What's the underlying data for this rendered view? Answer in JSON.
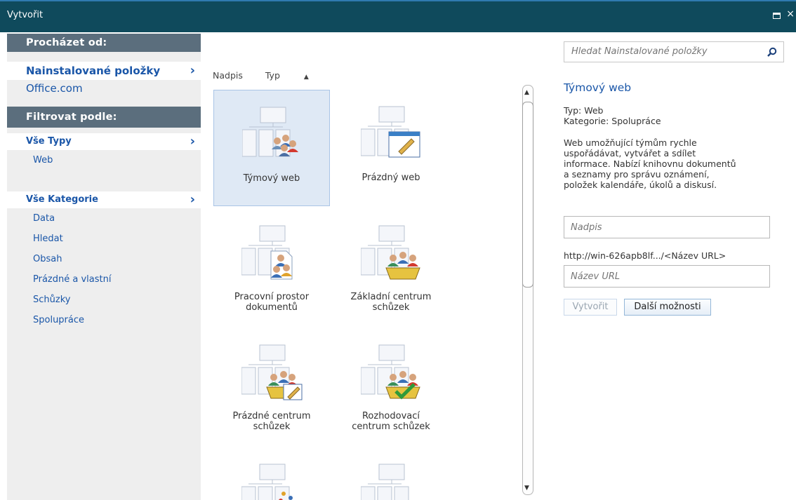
{
  "window": {
    "title": "Vytvořit"
  },
  "sidebar": {
    "browse_header": "Procházet od:",
    "sources": [
      {
        "label": "Nainstalované položky",
        "selected": true
      },
      {
        "label": "Office.com",
        "selected": false
      }
    ],
    "filter_header": "Filtrovat podle:",
    "type_filter": {
      "label": "Vše Typy",
      "items": [
        "Web"
      ]
    },
    "category_filter": {
      "label": "Vše Kategorie",
      "items": [
        "Data",
        "Hledat",
        "Obsah",
        "Prázdné a vlastní",
        "Schůzky",
        "Spolupráce"
      ]
    }
  },
  "columns": {
    "title": "Nadpis",
    "type": "Typ"
  },
  "templates": [
    {
      "line1": "Týmový web",
      "line2": "",
      "selected": true
    },
    {
      "line1": "Prázdný web",
      "line2": ""
    },
    {
      "line1": "Pracovní prostor",
      "line2": "dokumentů"
    },
    {
      "line1": "Základní centrum",
      "line2": "schůzek"
    },
    {
      "line1": "Prázdné centrum",
      "line2": "schůzek"
    },
    {
      "line1": "Rozhodovací",
      "line2": "centrum schůzek"
    },
    {
      "line1": "",
      "line2": ""
    },
    {
      "line1": "",
      "line2": ""
    }
  ],
  "search": {
    "placeholder": "Hledat Nainstalované položky"
  },
  "details": {
    "title": "Týmový web",
    "type": "Typ: Web",
    "category": "Kategorie: Spolupráce",
    "description_lines": [
      "Web umožňující týmům rychle",
      "uspořádávat, vytvářet a sdílet",
      "informace. Nabízí knihovnu dokumentů",
      "a seznamy pro správu oznámení,",
      "položek kalendáře, úkolů a diskusí."
    ],
    "title_placeholder": "Nadpis",
    "url_prefix": "http://win-626apb8lf.../<Název URL>",
    "url_placeholder": "Název URL",
    "create_label": "Vytvořit",
    "more_label": "Další možnosti"
  }
}
